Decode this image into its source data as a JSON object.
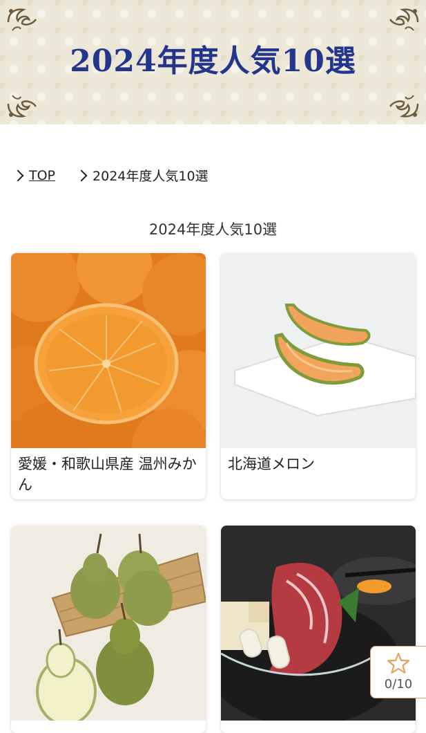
{
  "banner": {
    "title": "2024年度人気10選"
  },
  "breadcrumb": {
    "top_label": "TOP",
    "current_label": "2024年度人気10選"
  },
  "section": {
    "title": "2024年度人気10選"
  },
  "products": [
    {
      "name": "愛媛・和歌山県産 温州みかん",
      "image": "mandarin-oranges-photo"
    },
    {
      "name": "北海道メロン",
      "image": "melon-slices-photo"
    },
    {
      "name": "",
      "image": "pears-photo"
    },
    {
      "name": "",
      "image": "sukiyaki-beef-photo"
    }
  ],
  "favorites": {
    "count": "0/10",
    "icon": "star-icon"
  },
  "colors": {
    "title_blue": "#24358c",
    "banner_bg": "#ece7d6",
    "accent_orange": "#e2a260"
  }
}
